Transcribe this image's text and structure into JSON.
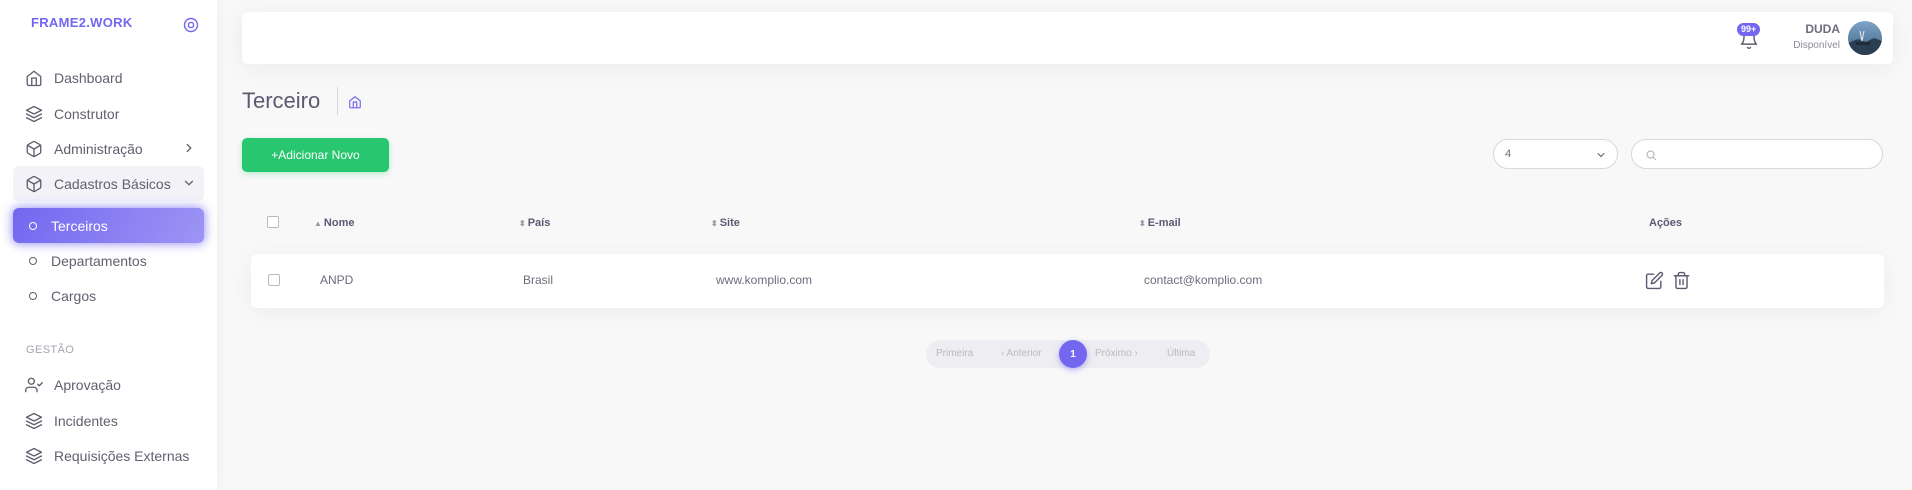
{
  "brand": "FRAME2.WORK",
  "sidebar": {
    "items": [
      {
        "label": "Dashboard",
        "icon": "home-icon"
      },
      {
        "label": "Construtor",
        "icon": "layers-icon"
      },
      {
        "label": "Administração",
        "icon": "package-icon"
      },
      {
        "label": "Cadastros Básicos",
        "icon": "package-icon"
      },
      {
        "label": "Terceiros",
        "icon": "circle-icon"
      },
      {
        "label": "Departamentos",
        "icon": "circle-icon"
      },
      {
        "label": "Cargos",
        "icon": "circle-icon"
      }
    ],
    "section_header": "GESTÃO",
    "gestao_items": [
      {
        "label": "Aprovação",
        "icon": "user-check-icon"
      },
      {
        "label": "Incidentes",
        "icon": "layers-icon"
      },
      {
        "label": "Requisições Externas",
        "icon": "layers-icon"
      }
    ]
  },
  "topbar": {
    "notification_badge": "99+",
    "user_name": "DUDA",
    "user_status": "Disponível"
  },
  "page": {
    "title": "Terceiro",
    "add_button": "+Adicionar Novo",
    "page_size": "4",
    "search_placeholder": ""
  },
  "table": {
    "headers": [
      "Nome",
      "País",
      "Site",
      "E-mail",
      "Ações"
    ],
    "rows": [
      {
        "nome": "ANPD",
        "pais": "Brasil",
        "site": "www.komplio.com",
        "email": "contact@komplio.com"
      }
    ]
  },
  "pagination": {
    "first": "Primeira",
    "prev": "‹ Anterior",
    "current": "1",
    "next": "Próximo ›",
    "last": "Última"
  },
  "colors": {
    "primary": "#7367f0",
    "success": "#28c76f",
    "background": "#f8f8f8",
    "text": "#6e6b7b"
  }
}
